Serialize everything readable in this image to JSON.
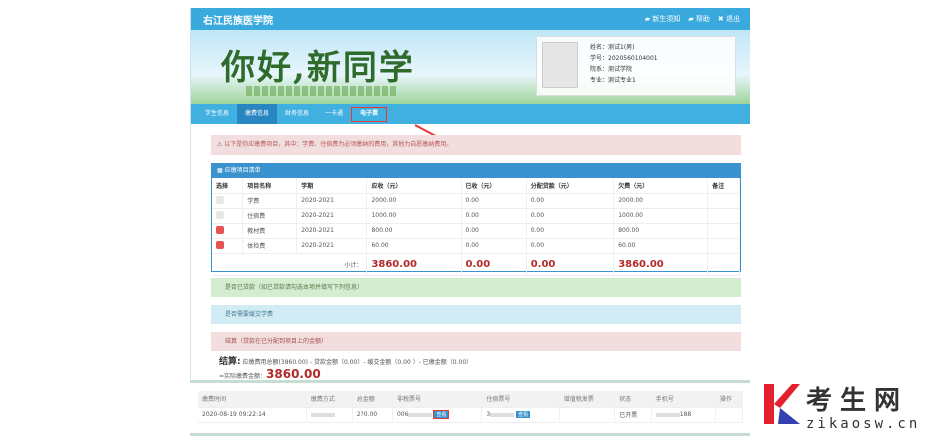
{
  "header": {
    "title": "右江民族医学院",
    "links": [
      "新生须知",
      "帮助",
      "退出"
    ]
  },
  "banner": {
    "slogan": "你好,新同学"
  },
  "profile": {
    "name": "姓名：测试1(男)",
    "id": "学号：2020560104001",
    "college": "院系：测试学院",
    "major": "专业：测试专业1"
  },
  "nav": {
    "items": [
      "学生信息",
      "缴费信息",
      "财务信息",
      "一卡通",
      "电子票"
    ],
    "active": "缴费信息",
    "highlighted": "电子票"
  },
  "alert": "以下是你应缴费项目，其中：学费、住宿费为必须缴纳的费用，其他为自愿缴纳费用。",
  "fees": {
    "title": "应缴项目清单",
    "columns": [
      "选择",
      "项目名称",
      "学期",
      "应收（元）",
      "已收（元）",
      "分配贷款（元）",
      "欠费（元）",
      "备注"
    ],
    "rows": [
      {
        "checked": false,
        "name": "学费",
        "term": "2020-2021",
        "due": "2000.00",
        "paid": "0.00",
        "loan": "0.00",
        "owed": "2000.00"
      },
      {
        "checked": false,
        "name": "住宿费",
        "term": "2020-2021",
        "due": "1000.00",
        "paid": "0.00",
        "loan": "0.00",
        "owed": "1000.00"
      },
      {
        "checked": true,
        "name": "教材费",
        "term": "2020-2021",
        "due": "800.00",
        "paid": "0.00",
        "loan": "0.00",
        "owed": "800.00"
      },
      {
        "checked": true,
        "name": "体检费",
        "term": "2020-2021",
        "due": "60.00",
        "paid": "0.00",
        "loan": "0.00",
        "owed": "60.00"
      }
    ],
    "subtotal_label": "小计：",
    "subtotal": {
      "due": "3860.00",
      "paid": "0.00",
      "loan": "0.00",
      "owed": "3860.00"
    }
  },
  "sections": {
    "loan": "是否已贷款（如已贷款请勾选本项并填写下列信息）",
    "defer": "是否需要缓交学费",
    "settle_title": "结算（贷款在已分配到项目上的金额）"
  },
  "settle": {
    "label": "结算:",
    "formula": "应缴费用总额(3860.00) - 贷款金额（0.00）- 缓交金额（0.00 ）- 已缴金额（0.00）",
    "actual_label": "=实际缴费金额：",
    "actual": "3860.00"
  },
  "payments": {
    "columns": [
      "缴费时间",
      "缴费方式",
      "总金额",
      "非税票号",
      "住宿票号",
      "增值税发票",
      "状态",
      "手机号",
      "操作"
    ],
    "rows": [
      {
        "time": "2020-08-19 09:22:14",
        "amount": "2?0.00",
        "tax_no": "006",
        "view1": "查看",
        "room_no": "3",
        "view2": "查看",
        "status": "已开票",
        "phone": "188"
      }
    ]
  },
  "colors": {
    "primary": "#3aa9dd",
    "accent": "#e53935",
    "amount": "#b22a2a"
  },
  "watermark": {
    "text": "考生网",
    "url": "zikaosw.cn"
  }
}
